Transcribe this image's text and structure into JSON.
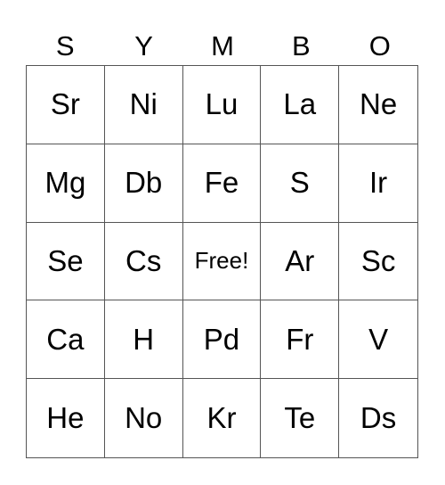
{
  "header": [
    "S",
    "Y",
    "M",
    "B",
    "O"
  ],
  "cells": [
    [
      "Sr",
      "Ni",
      "Lu",
      "La",
      "Ne"
    ],
    [
      "Mg",
      "Db",
      "Fe",
      "S",
      "Ir"
    ],
    [
      "Se",
      "Cs",
      "Free!",
      "Ar",
      "Sc"
    ],
    [
      "Ca",
      "H",
      "Pd",
      "Fr",
      "V"
    ],
    [
      "He",
      "No",
      "Kr",
      "Te",
      "Ds"
    ]
  ]
}
